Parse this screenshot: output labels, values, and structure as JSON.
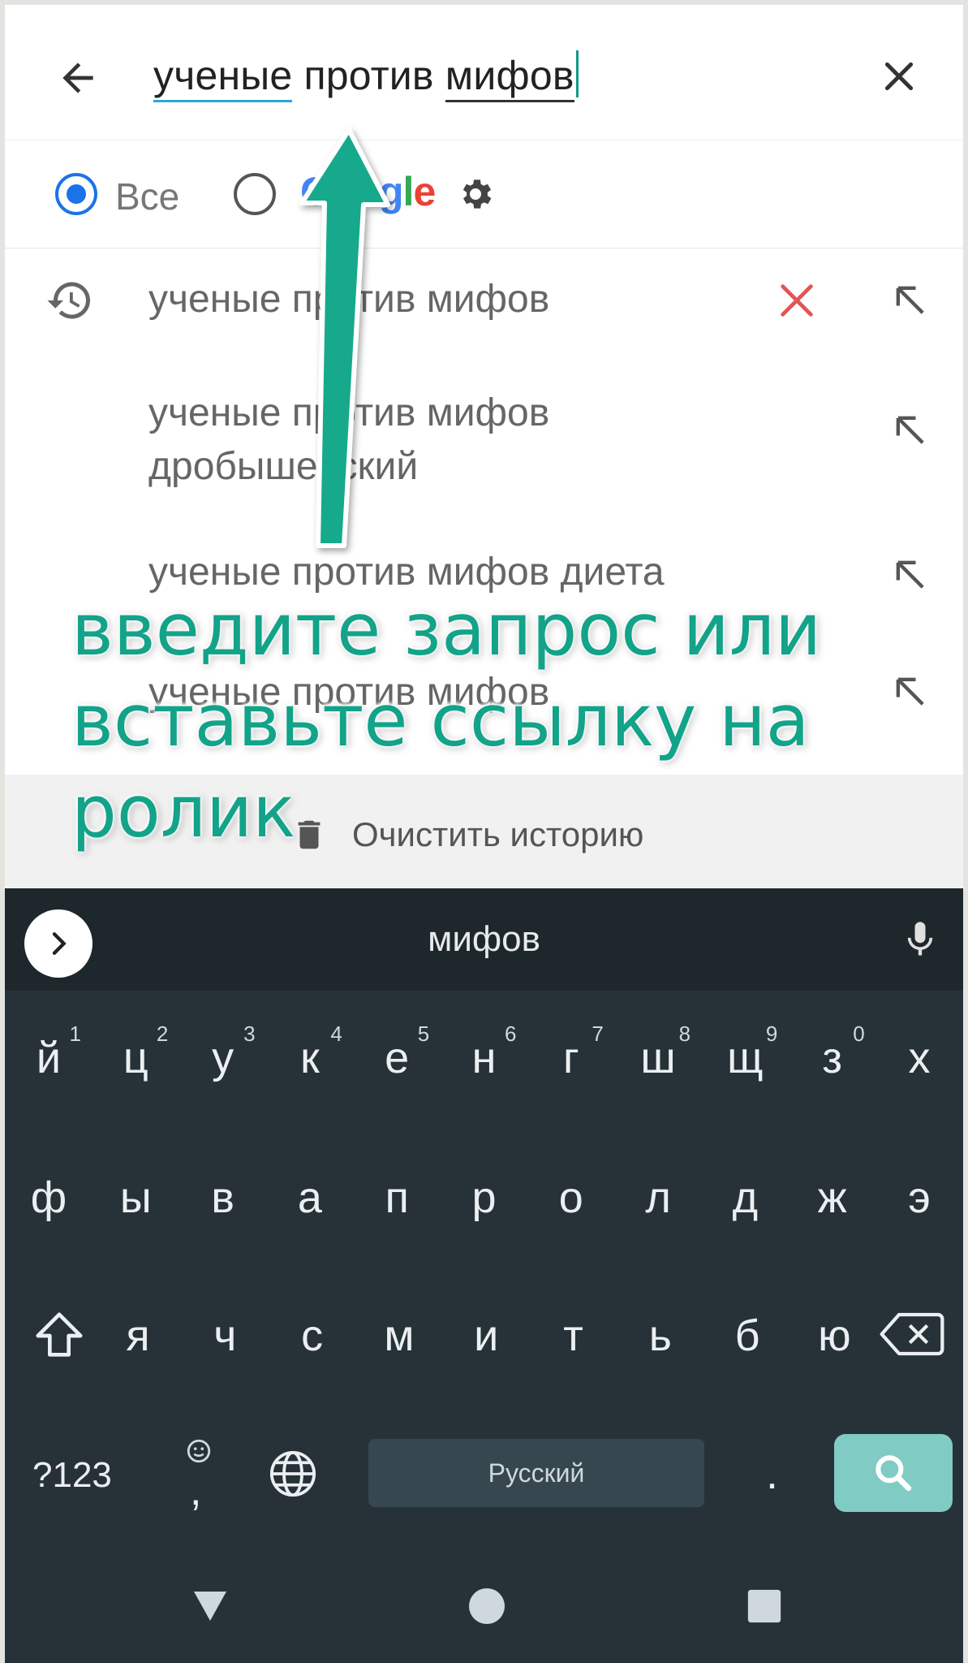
{
  "search": {
    "query_words": [
      "ученые",
      "против",
      "мифов"
    ]
  },
  "filter": {
    "all_label": "Все",
    "google_letters": [
      "G",
      "o",
      "o",
      "g",
      "l",
      "e"
    ]
  },
  "suggestions": [
    {
      "line1": "ученые против мифов",
      "line2": "",
      "history": true
    },
    {
      "line1": "ученые против мифов",
      "line2": "дробышевский",
      "history": false
    },
    {
      "line1": "ученые против мифов диета",
      "line2": "",
      "history": false
    },
    {
      "line1": "ученые против мифов",
      "line2": "",
      "history": false
    }
  ],
  "clear_history_label": "Очистить историю",
  "keyboard": {
    "suggestion_word": "мифов",
    "row1": [
      {
        "k": "й",
        "h": "1"
      },
      {
        "k": "ц",
        "h": "2"
      },
      {
        "k": "у",
        "h": "3"
      },
      {
        "k": "к",
        "h": "4"
      },
      {
        "k": "е",
        "h": "5"
      },
      {
        "k": "н",
        "h": "6"
      },
      {
        "k": "г",
        "h": "7"
      },
      {
        "k": "ш",
        "h": "8"
      },
      {
        "k": "щ",
        "h": "9"
      },
      {
        "k": "з",
        "h": "0"
      },
      {
        "k": "х",
        "h": ""
      }
    ],
    "row2": [
      "ф",
      "ы",
      "в",
      "а",
      "п",
      "р",
      "о",
      "л",
      "д",
      "ж",
      "э"
    ],
    "row3": [
      "я",
      "ч",
      "с",
      "м",
      "и",
      "т",
      "ь",
      "б",
      "ю"
    ],
    "symbols_label": "?123",
    "comma_label": ",",
    "space_label": "Русский",
    "period_label": "."
  },
  "annotation": {
    "line1": "введите запрос или",
    "line2": "вставьте ссылку на",
    "line3": "ролик"
  },
  "colors": {
    "accent_blue": "#1a73e8",
    "keyboard_bg": "#263238",
    "search_key": "#80cbc4",
    "annotation": "#12a389",
    "delete_x": "#e05555"
  },
  "icons": [
    "back-arrow-icon",
    "close-icon",
    "history-icon",
    "delete-icon",
    "north-west-arrow-icon",
    "gear-icon",
    "trash-icon",
    "chevron-right-icon",
    "mic-icon",
    "shift-icon",
    "backspace-icon",
    "emoji-icon",
    "globe-icon",
    "search-icon",
    "back-triangle-icon",
    "home-circle-icon",
    "recents-square-icon"
  ]
}
